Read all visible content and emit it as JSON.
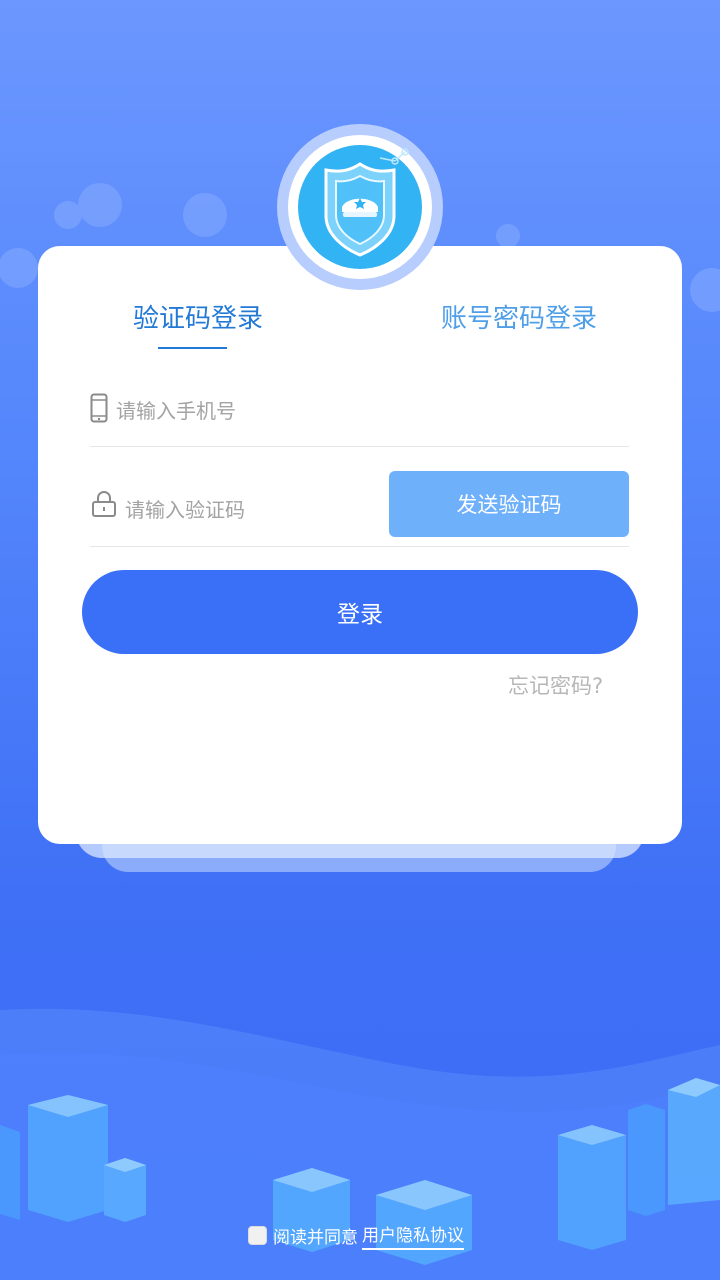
{
  "tabs": [
    {
      "label": "验证码登录",
      "active": true
    },
    {
      "label": "账号密码登录",
      "active": false
    }
  ],
  "phone": {
    "placeholder": "请输入手机号",
    "value": "",
    "icon": "phone-icon"
  },
  "code": {
    "placeholder": "请输入验证码",
    "value": "",
    "icon": "lock-icon",
    "send_label": "发送验证码"
  },
  "login_label": "登录",
  "forgot_label": "忘记密码?",
  "agreement": {
    "prefix": "阅读并同意",
    "link": "用户隐私协议",
    "checked": false
  },
  "colors": {
    "accent": "#3a70f8",
    "tab_active": "#2279d6",
    "tab_inactive": "#4f9ee8",
    "send_button": "#6fb0fb",
    "background_top": "#6b97fe",
    "background_bottom": "#3a6cf4"
  }
}
